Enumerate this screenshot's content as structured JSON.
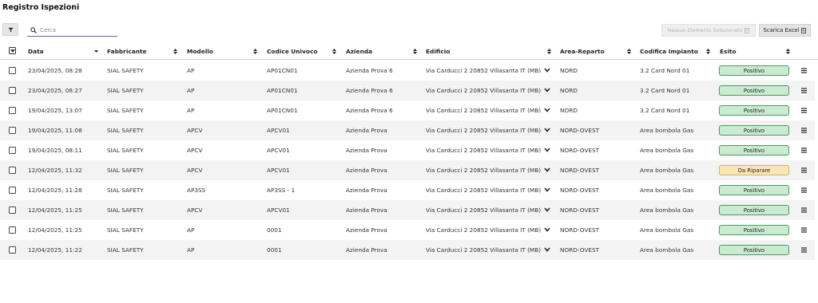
{
  "page_title": "Registro Ispezioni",
  "toolbar": {
    "search_placeholder": "Cerca",
    "no_selection_label": "Nessun Elemento Selezionato",
    "excel_label": "Scarica Excel"
  },
  "columns": {
    "data": "Data",
    "fabbricante": "Fabbricante",
    "modello": "Modello",
    "codice": "Codice Univoco",
    "azienda": "Azienda",
    "edificio": "Edificio",
    "area": "Area-Reparto",
    "codifica": "Codifica Impianto",
    "esito": "Esito"
  },
  "colors": {
    "positivo_bg": "#c9ebd0",
    "positivo_border": "#4e9a5e",
    "riparare_bg": "#fbe6b3",
    "riparare_border": "#d7b45e",
    "row_alt": "#f3f3f3"
  },
  "icons": {
    "filter": "filter-icon",
    "search": "search-icon",
    "document": "document-icon",
    "sort": "sort-icon",
    "chevron": "chevron-down-icon",
    "menu": "hamburger-menu-icon"
  },
  "rows": [
    {
      "data": "23/04/2025, 08:28",
      "fabbricante": "SIAL SAFETY",
      "modello": "AP",
      "codice": "AP01CN01",
      "azienda": "Azienda Prova 6",
      "edificio": "Via Carducci 2 20852 Villasanta IT (MB)",
      "area": "NORD",
      "codifica": "3.2 Card Nord 01",
      "esito": "Positivo",
      "status": "pos"
    },
    {
      "data": "23/04/2025, 08:27",
      "fabbricante": "SIAL SAFETY",
      "modello": "AP",
      "codice": "AP01CN01",
      "azienda": "Azienda Prova 6",
      "edificio": "Via Carducci 2 20852 Villasanta IT (MB)",
      "area": "NORD",
      "codifica": "3.2 Card Nord 01",
      "esito": "Positivo",
      "status": "pos"
    },
    {
      "data": "19/04/2025, 13:07",
      "fabbricante": "SIAL SAFETY",
      "modello": "AP",
      "codice": "AP01CN01",
      "azienda": "Azienda Prova 6",
      "edificio": "Via Carducci 2 20852 Villasanta IT (MB)",
      "area": "NORD",
      "codifica": "3.2 Card Nord 01",
      "esito": "Positivo",
      "status": "pos"
    },
    {
      "data": "19/04/2025, 11:08",
      "fabbricante": "SIAL SAFETY",
      "modello": "APCV",
      "codice": "APCV01",
      "azienda": "Azienda Prova",
      "edificio": "Via Carducci 2 20852 Villasanta IT (MB)",
      "area": "NORD-OVEST",
      "codifica": "Area bombola Gas",
      "esito": "Positivo",
      "status": "pos"
    },
    {
      "data": "19/04/2025, 08:11",
      "fabbricante": "SIAL SAFETY",
      "modello": "APCV",
      "codice": "APCV01",
      "azienda": "Azienda Prova",
      "edificio": "Via Carducci 2 20852 Villasanta IT (MB)",
      "area": "NORD-OVEST",
      "codifica": "Area bombola Gas",
      "esito": "Positivo",
      "status": "pos"
    },
    {
      "data": "12/04/2025, 11:32",
      "fabbricante": "SIAL SAFETY",
      "modello": "APCV",
      "codice": "APCV01",
      "azienda": "Azienda Prova",
      "edificio": "Via Carducci 2 20852 Villasanta IT (MB)",
      "area": "NORD-OVEST",
      "codifica": "Area bombola Gas",
      "esito": "Da Riparare",
      "status": "rip"
    },
    {
      "data": "12/04/2025, 11:28",
      "fabbricante": "SIAL SAFETY",
      "modello": "AP3SS",
      "codice": "AP3SS - 1",
      "azienda": "Azienda Prova",
      "edificio": "Via Carducci 2 20852 Villasanta IT (MB)",
      "area": "NORD-OVEST",
      "codifica": "Area bombola Gas",
      "esito": "Positivo",
      "status": "pos"
    },
    {
      "data": "12/04/2025, 11:25",
      "fabbricante": "SIAL SAFETY",
      "modello": "APCV",
      "codice": "APCV01",
      "azienda": "Azienda Prova",
      "edificio": "Via Carducci 2 20852 Villasanta IT (MB)",
      "area": "NORD-OVEST",
      "codifica": "Area bombola Gas",
      "esito": "Positivo",
      "status": "pos"
    },
    {
      "data": "12/04/2025, 11:25",
      "fabbricante": "SIAL SAFETY",
      "modello": "AP",
      "codice": "0001",
      "azienda": "Azienda Prova",
      "edificio": "Via Carducci 2 20852 Villasanta IT (MB)",
      "area": "NORD-OVEST",
      "codifica": "Area bombola Gas",
      "esito": "Positivo",
      "status": "pos"
    },
    {
      "data": "12/04/2025, 11:22",
      "fabbricante": "SIAL SAFETY",
      "modello": "AP",
      "codice": "0001",
      "azienda": "Azienda Prova",
      "edificio": "Via Carducci 2 20852 Villasanta IT (MB)",
      "area": "NORD-OVEST",
      "codifica": "Area bombola Gas",
      "esito": "Positivo",
      "status": "pos"
    }
  ]
}
